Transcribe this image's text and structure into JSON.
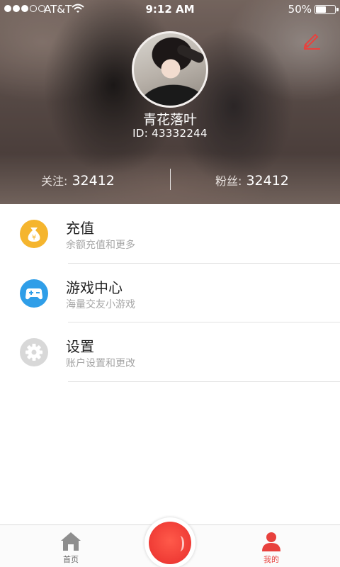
{
  "status_bar": {
    "carrier": "AT&T",
    "time": "9:12 AM",
    "battery_percent": "50%",
    "battery_level": 0.5,
    "signal_bars_filled": 3,
    "signal_bars_total": 5
  },
  "profile": {
    "username": "青花落叶",
    "user_id": "ID: 43332244",
    "follow_label": "关注:",
    "follow_count": "32412",
    "fans_label": "粉丝:",
    "fans_count": "32412",
    "edit_icon": "pencil-icon"
  },
  "menu": [
    {
      "title": "充值",
      "subtitle": "余额充值和更多",
      "icon": "money-bag-icon",
      "icon_color": "#f5b52e"
    },
    {
      "title": "游戏中心",
      "subtitle": "海量交友小游戏",
      "icon": "gamepad-icon",
      "icon_color": "#2f9ee8"
    },
    {
      "title": "设置",
      "subtitle": "账户设置和更改",
      "icon": "gear-icon",
      "icon_color": "#d8d8d8"
    }
  ],
  "tabbar": {
    "home_label": "首页",
    "mine_label": "我的",
    "active_tab": "mine",
    "accent_color": "#e8413d"
  }
}
